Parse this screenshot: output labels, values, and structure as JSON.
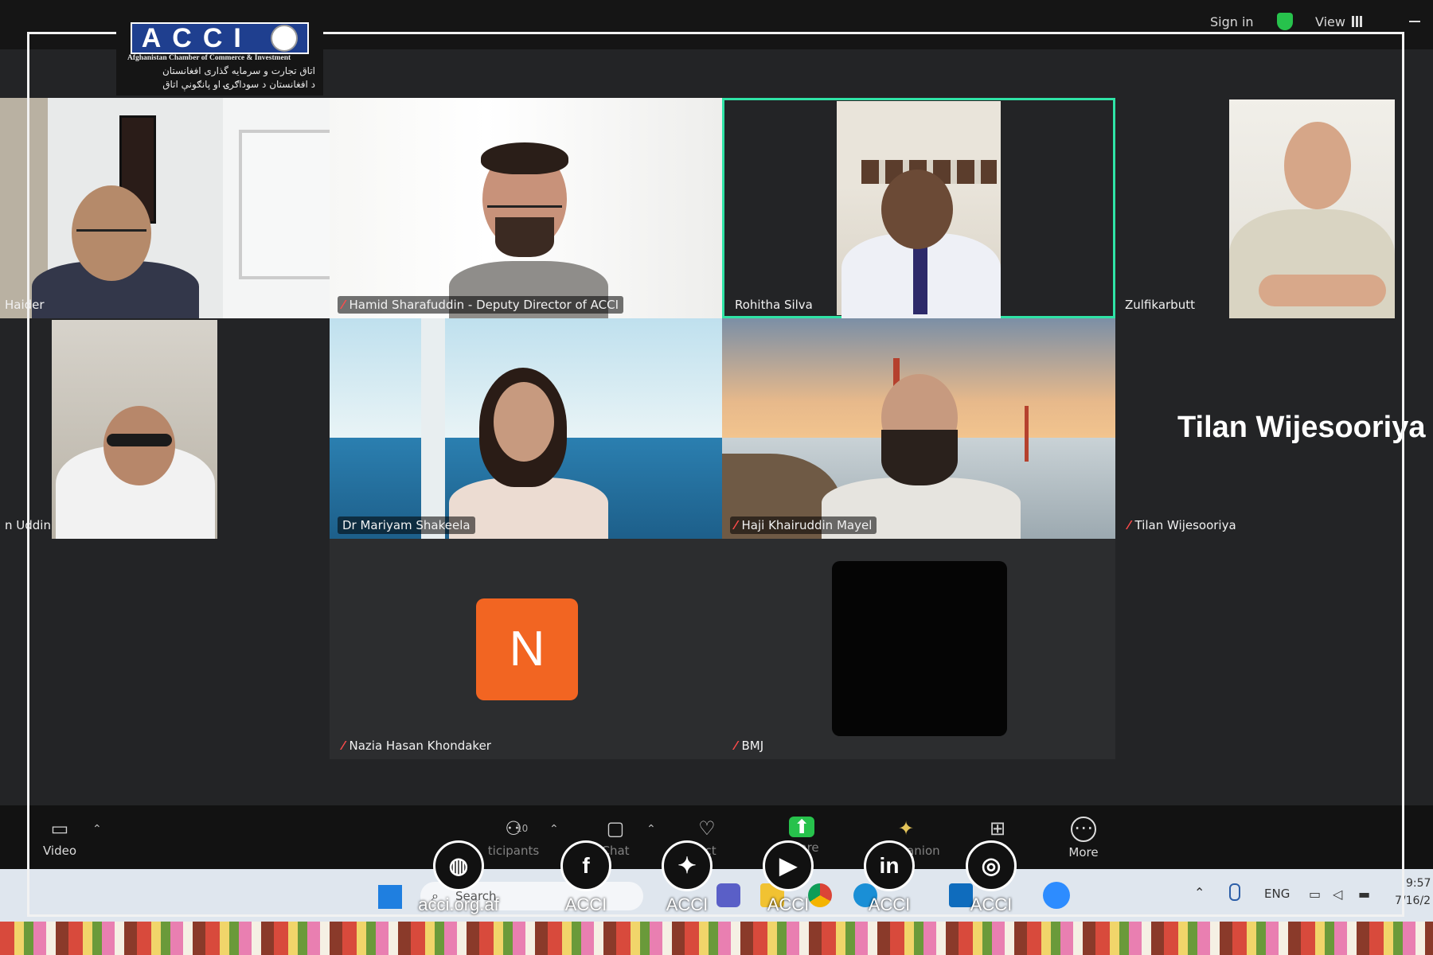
{
  "topbar": {
    "sign_in": "Sign in",
    "view": "View"
  },
  "logo": {
    "text": "ACCI",
    "english": "Afghanistan Chamber of Commerce & Investment",
    "dari": "اتاق تجارت و سرمایه گذاری افغانستان",
    "pashto": "د افغانستان د سوداګرۍ او پانګونې اتاق"
  },
  "participants": [
    {
      "name": "Haider",
      "muted": false
    },
    {
      "name": "Hamid Sharafuddin - Deputy Director of ACCI",
      "muted": true
    },
    {
      "name": "Rohitha Silva",
      "muted": false,
      "active_speaker": true
    },
    {
      "name": "Zulfikarbutt",
      "muted": false
    },
    {
      "name": "n Uddin",
      "muted": false
    },
    {
      "name": "Dr Mariyam Shakeela",
      "muted": false
    },
    {
      "name": "Haji Khairuddin Mayel",
      "muted": true
    },
    {
      "name": "Tilan Wijesooriya",
      "muted": true,
      "big_label": "Tilan Wijesooriya"
    },
    {
      "name": "Nazia Hasan Khondaker",
      "muted": true,
      "avatar_letter": "N"
    },
    {
      "name": "BMJ",
      "muted": true
    }
  ],
  "controls": {
    "video": "Video",
    "participants": "ticipants",
    "participants_count": "10",
    "chat": "Chat",
    "react": "act",
    "share": "Share",
    "companion": "Companion",
    "more": "More"
  },
  "taskbar": {
    "search": "Search",
    "lang": "ENG",
    "time": "9:57",
    "date": "7/16/2"
  },
  "social": [
    {
      "icon": "globe-icon",
      "label": "acci.org.af"
    },
    {
      "icon": "facebook-icon",
      "label": "ACCI"
    },
    {
      "icon": "twitter-icon",
      "label": "ACCI"
    },
    {
      "icon": "youtube-icon",
      "label": "ACCI"
    },
    {
      "icon": "linkedin-icon",
      "label": "ACCI"
    },
    {
      "icon": "instagram-icon",
      "label": "ACCI"
    }
  ],
  "colors": {
    "active_speaker_border": "#2fe3a6",
    "avatar_orange": "#f26522",
    "mute_red": "#ff4b4b",
    "shield_green": "#27c24c"
  }
}
